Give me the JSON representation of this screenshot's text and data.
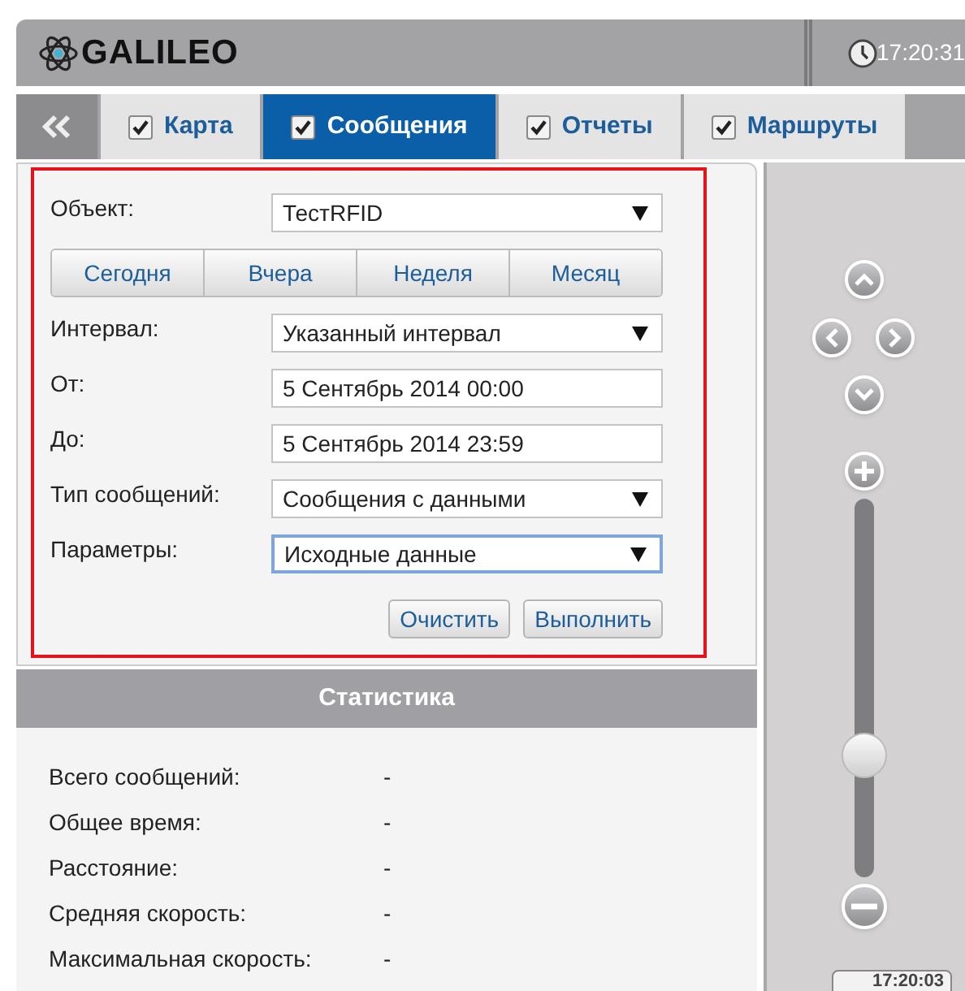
{
  "header": {
    "logo": "GALILEO",
    "time": "17:20:31"
  },
  "tabs": [
    {
      "label": "Карта",
      "checked": true,
      "selected": false
    },
    {
      "label": "Сообщения",
      "checked": true,
      "selected": true
    },
    {
      "label": "Отчеты",
      "checked": true,
      "selected": false
    },
    {
      "label": "Маршруты",
      "checked": true,
      "selected": false
    }
  ],
  "form": {
    "rows": [
      {
        "kind": "select",
        "label": "Объект:",
        "value": "ТестRFID",
        "focused": false
      },
      {
        "kind": "periods",
        "buttons": [
          "Сегодня",
          "Вчера",
          "Неделя",
          "Месяц"
        ]
      },
      {
        "kind": "select",
        "label": "Интервал:",
        "value": "Указанный интервал",
        "focused": false
      },
      {
        "kind": "input",
        "label": "От:",
        "value": "5 Сентябрь 2014 00:00",
        "focused": false
      },
      {
        "kind": "input",
        "label": "До:",
        "value": "5 Сентябрь 2014 23:59",
        "focused": false
      },
      {
        "kind": "select",
        "label": "Тип сообщений:",
        "value": "Сообщения с данными",
        "focused": false
      },
      {
        "kind": "select",
        "label": "Параметры:",
        "value": "Исходные данные",
        "focused": true
      }
    ],
    "actions": [
      "Очистить",
      "Выполнить"
    ]
  },
  "statistics": {
    "title": "Статистика",
    "rows": [
      {
        "label": "Всего сообщений:",
        "value": "-"
      },
      {
        "label": "Общее время:",
        "value": "-"
      },
      {
        "label": "Расстояние:",
        "value": "-"
      },
      {
        "label": "Средняя скорость:",
        "value": "-"
      },
      {
        "label": "Максимальная скорость:",
        "value": "-"
      }
    ]
  },
  "map": {
    "zoom": {
      "level": 0.32
    },
    "time": "17:20:03"
  }
}
